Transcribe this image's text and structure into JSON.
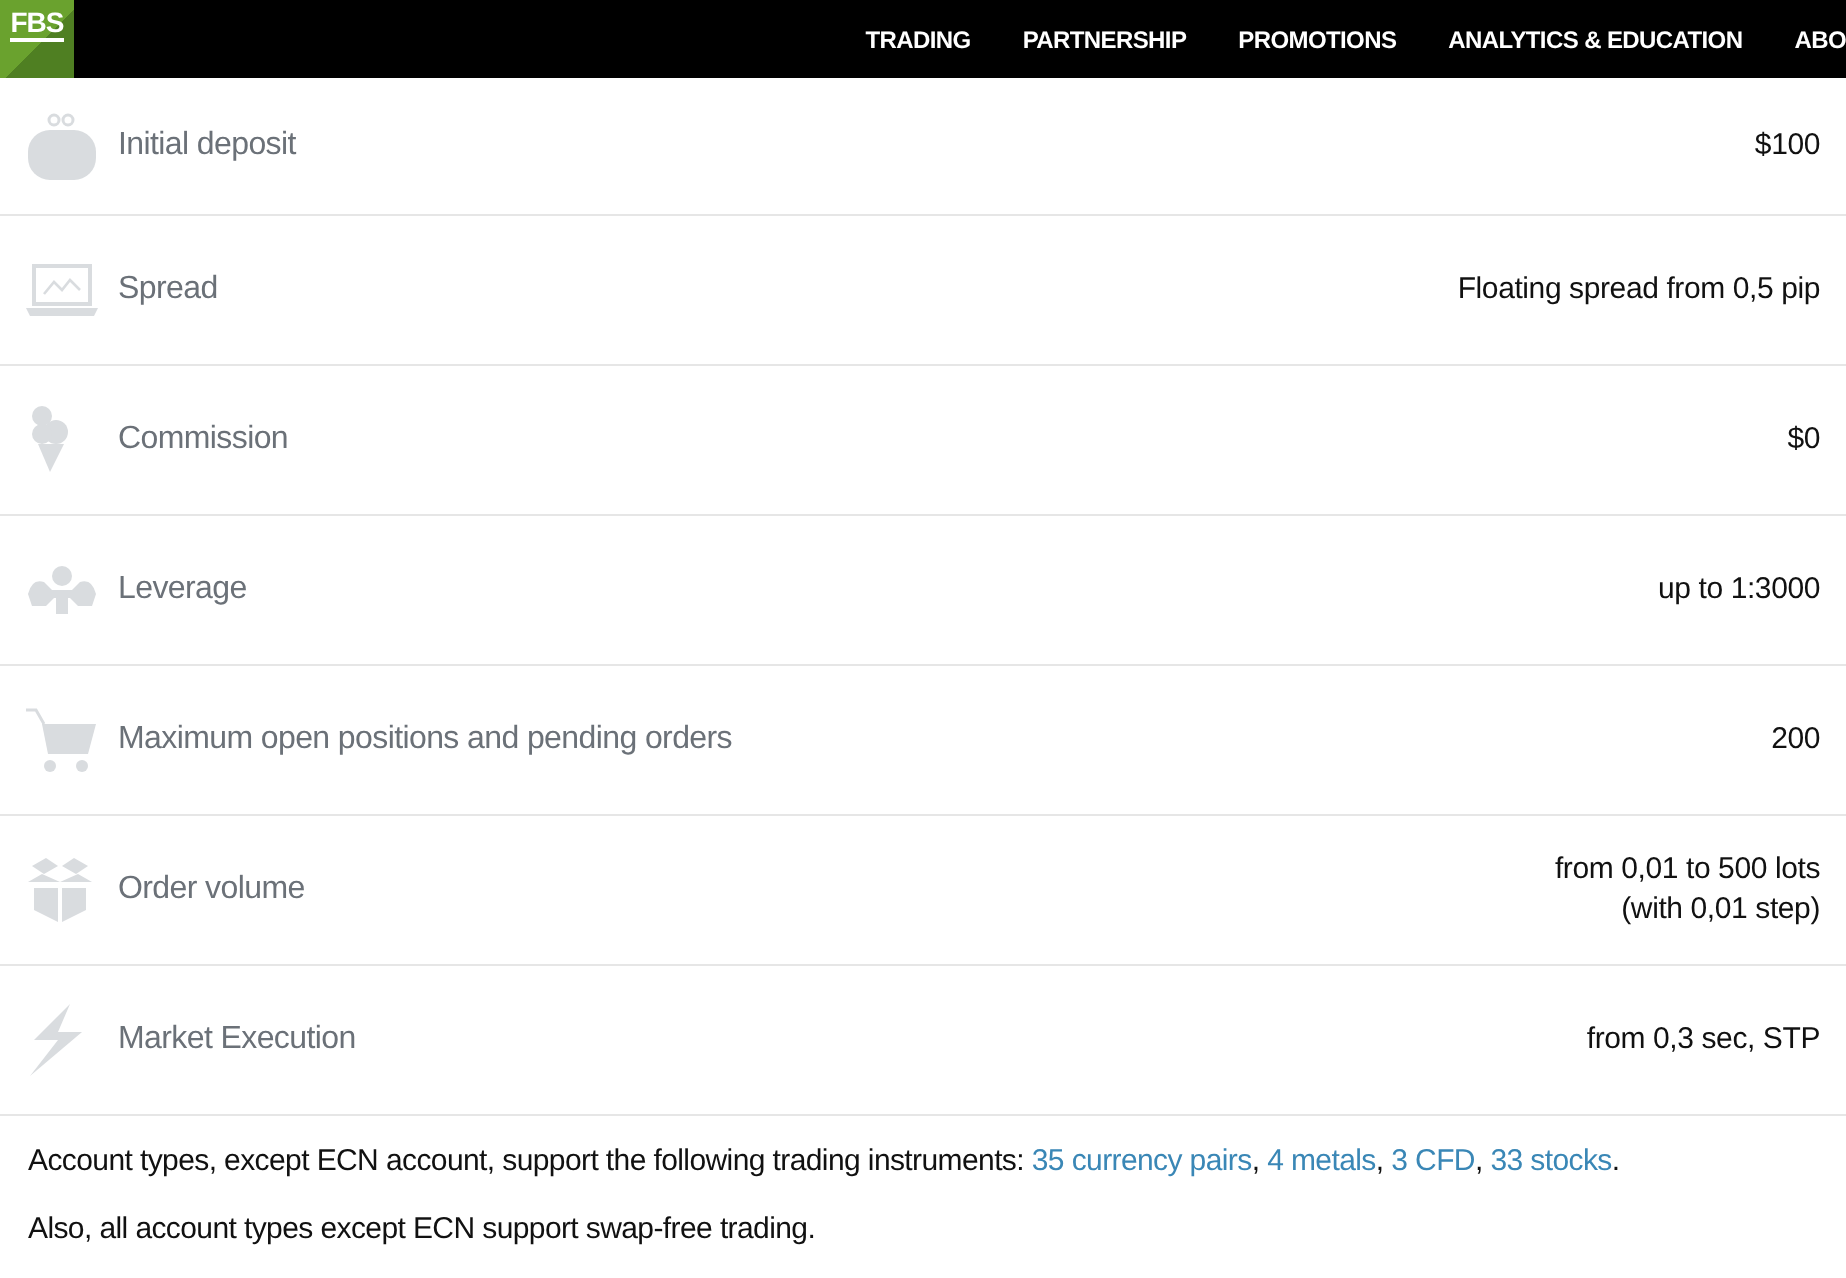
{
  "header": {
    "logo": "FBS",
    "nav": [
      {
        "label": "TRADING"
      },
      {
        "label": "PARTNERSHIP"
      },
      {
        "label": "PROMOTIONS"
      },
      {
        "label": "ANALYTICS & EDUCATION"
      },
      {
        "label": "ABO"
      }
    ]
  },
  "conditions": [
    {
      "kind": "wallet",
      "label": "Initial deposit",
      "value": [
        "$100"
      ]
    },
    {
      "kind": "laptop",
      "label": "Spread",
      "value": [
        "Floating spread from 0,5 pip"
      ]
    },
    {
      "kind": "icecream",
      "label": "Commission",
      "value": [
        "$0"
      ]
    },
    {
      "kind": "muscle",
      "label": "Leverage",
      "value": [
        "up to 1:3000"
      ]
    },
    {
      "kind": "cart",
      "label": "Maximum open positions and pending orders",
      "value": [
        "200"
      ]
    },
    {
      "kind": "box",
      "label": "Order volume",
      "value": [
        "from 0,01 to 500 lots",
        "(with 0,01 step)"
      ]
    },
    {
      "kind": "bolt",
      "label": "Market Execution",
      "value": [
        "from 0,3 sec, STP"
      ]
    }
  ],
  "notes": [
    {
      "parts": [
        {
          "kind": "text",
          "text": "Account types, except ECN account, support the following trading instruments: "
        },
        {
          "kind": "link",
          "text": "35 currency pairs"
        },
        {
          "kind": "text",
          "text": ", "
        },
        {
          "kind": "link",
          "text": "4 metals"
        },
        {
          "kind": "text",
          "text": ", "
        },
        {
          "kind": "link",
          "text": "3 CFD"
        },
        {
          "kind": "text",
          "text": ", "
        },
        {
          "kind": "link",
          "text": "33 stocks"
        },
        {
          "kind": "text",
          "text": "."
        }
      ]
    },
    {
      "parts": [
        {
          "kind": "text",
          "text": "Also, all account types except ECN support swap-free trading."
        }
      ]
    }
  ]
}
